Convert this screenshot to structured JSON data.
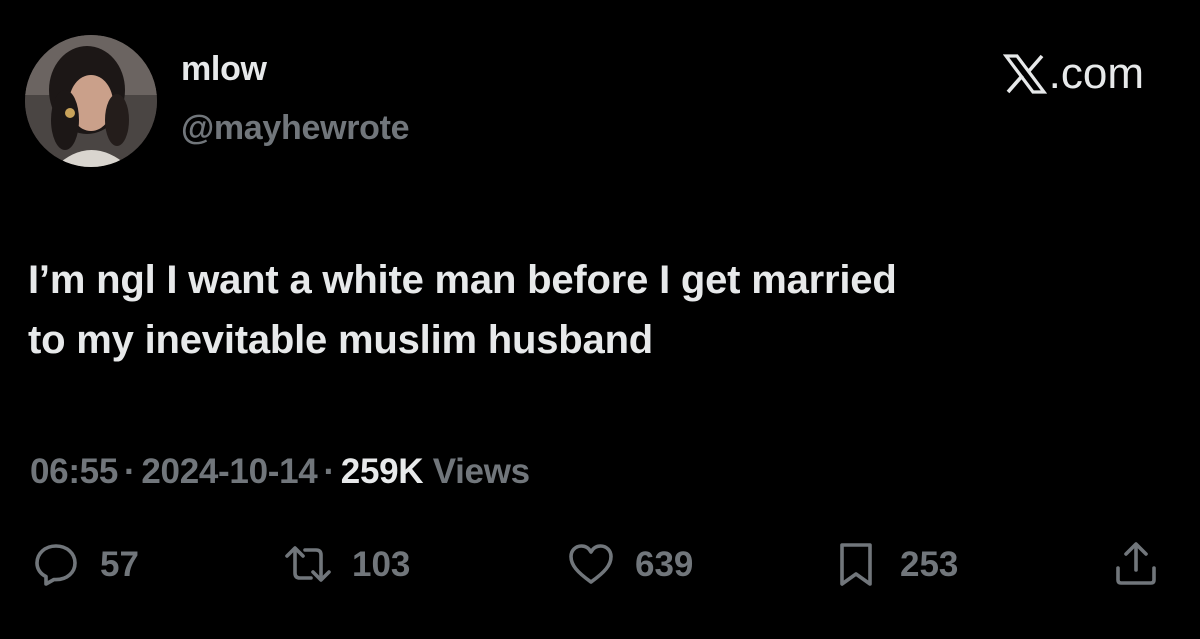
{
  "author": {
    "display_name": "mlow",
    "handle": "@mayhewrote"
  },
  "brand": {
    "label": ".com",
    "icon": "x-logo-icon"
  },
  "tweet": {
    "text_line_1": "I’m ngl I want a white man before I get married",
    "text_line_2": "to my inevitable muslim husband"
  },
  "meta": {
    "time": "06:55",
    "date": "2024-10-14",
    "views_count": "259K",
    "views_label": "Views",
    "separator": "·"
  },
  "actions": {
    "reply": {
      "icon": "reply-icon",
      "count": "57"
    },
    "repost": {
      "icon": "repost-icon",
      "count": "103"
    },
    "like": {
      "icon": "heart-icon",
      "count": "639"
    },
    "bookmark": {
      "icon": "bookmark-icon",
      "count": "253"
    },
    "share": {
      "icon": "share-icon"
    }
  },
  "colors": {
    "background": "#000000",
    "primary_text": "#e7e9ea",
    "secondary_text": "#71767b"
  }
}
